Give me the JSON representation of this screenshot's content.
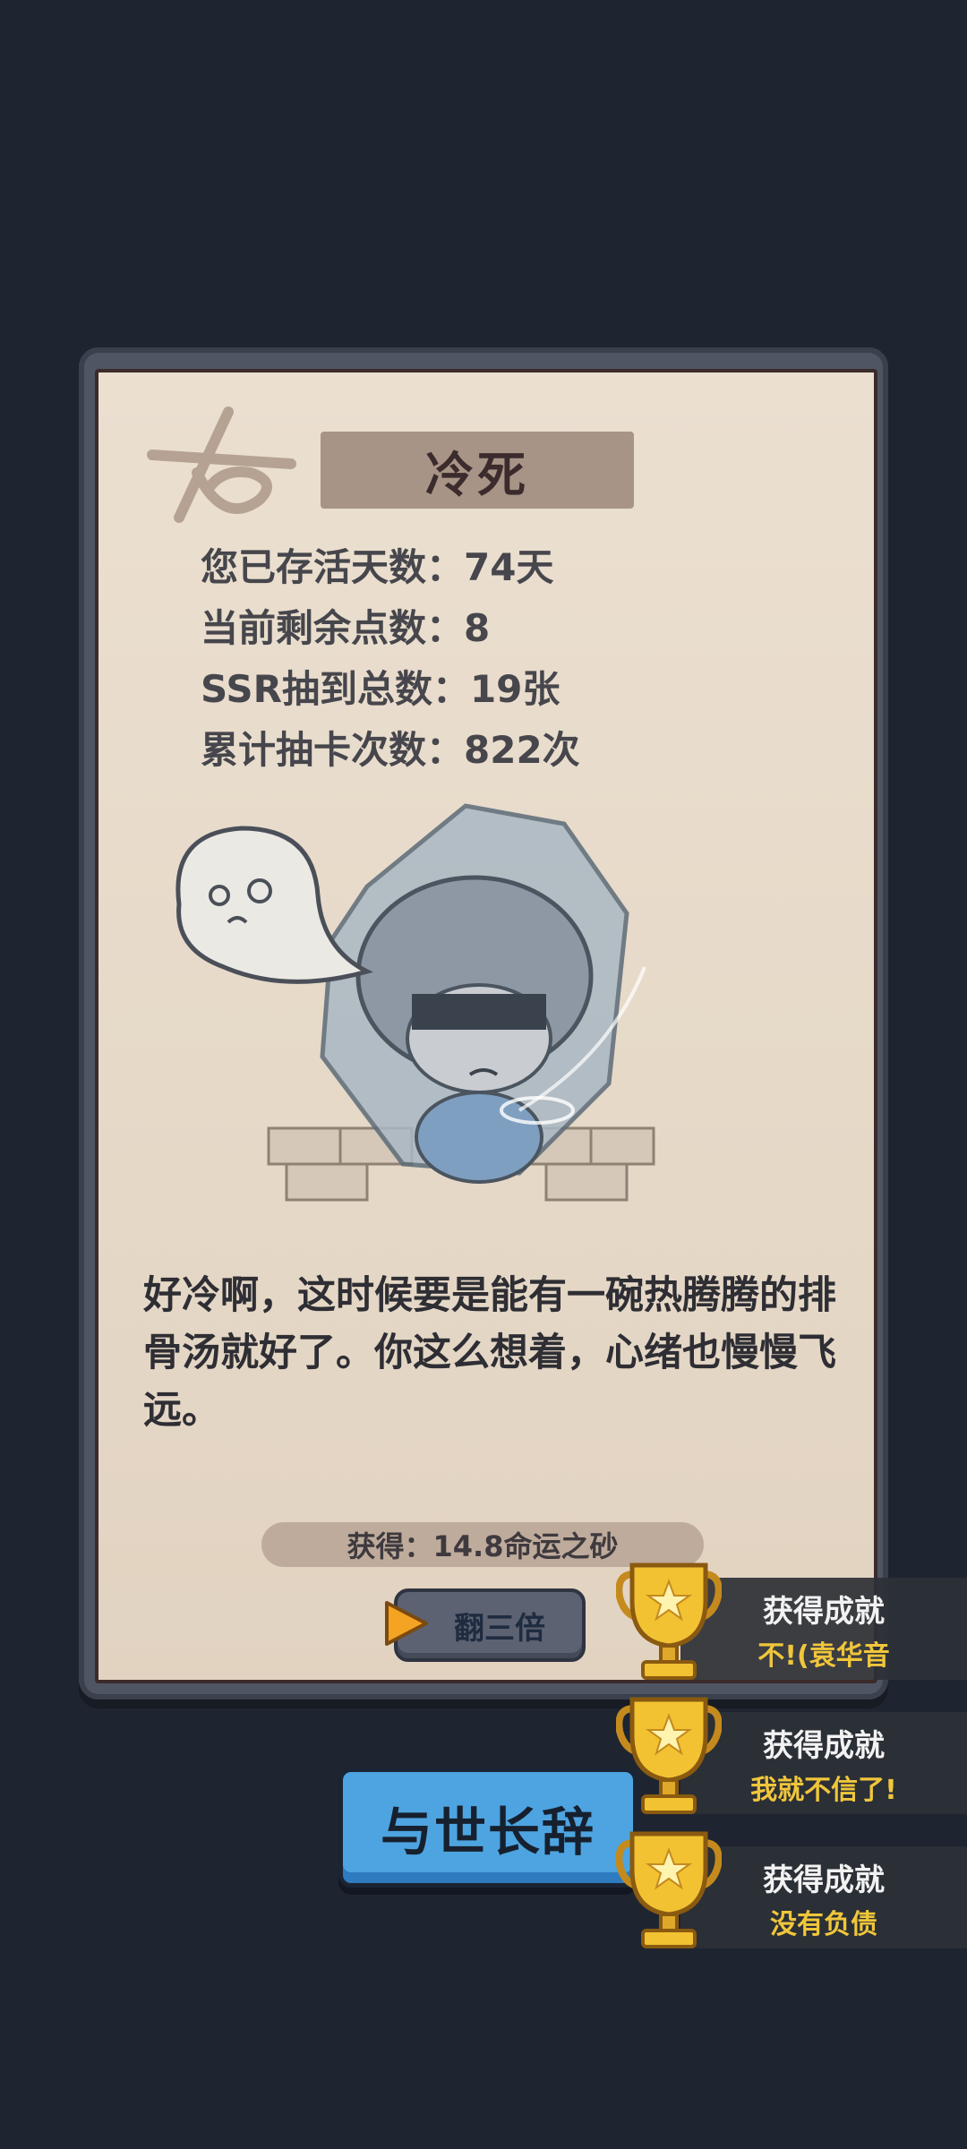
{
  "card": {
    "title": "冷死",
    "stats": [
      "您已存活天数：74天",
      "当前剩余点数：8",
      "SSR抽到总数：19张",
      "累计抽卡次数：822次"
    ],
    "story": "好冷啊，这时候要是能有一碗热腾腾的排骨汤就好了。你这么想着，心绪也慢慢飞远。",
    "reward": "获得：14.8命运之砂",
    "triple_button": "翻三倍"
  },
  "farewell_button": "与世长辞",
  "achievements": [
    {
      "title": "获得成就",
      "name": "不!(袁华音"
    },
    {
      "title": "获得成就",
      "name": "我就不信了!"
    },
    {
      "title": "获得成就",
      "name": "没有负债"
    }
  ],
  "colors": {
    "background": "#1e2531",
    "card": "#e8dccb",
    "button_blue": "#4da4e0",
    "achievement_text": "#f0c63b",
    "trophy_gold": "#f2c233"
  },
  "icons": {
    "stamp": "death-stamp-icon",
    "play": "play-triangle-icon",
    "trophy": "trophy-star-icon"
  }
}
